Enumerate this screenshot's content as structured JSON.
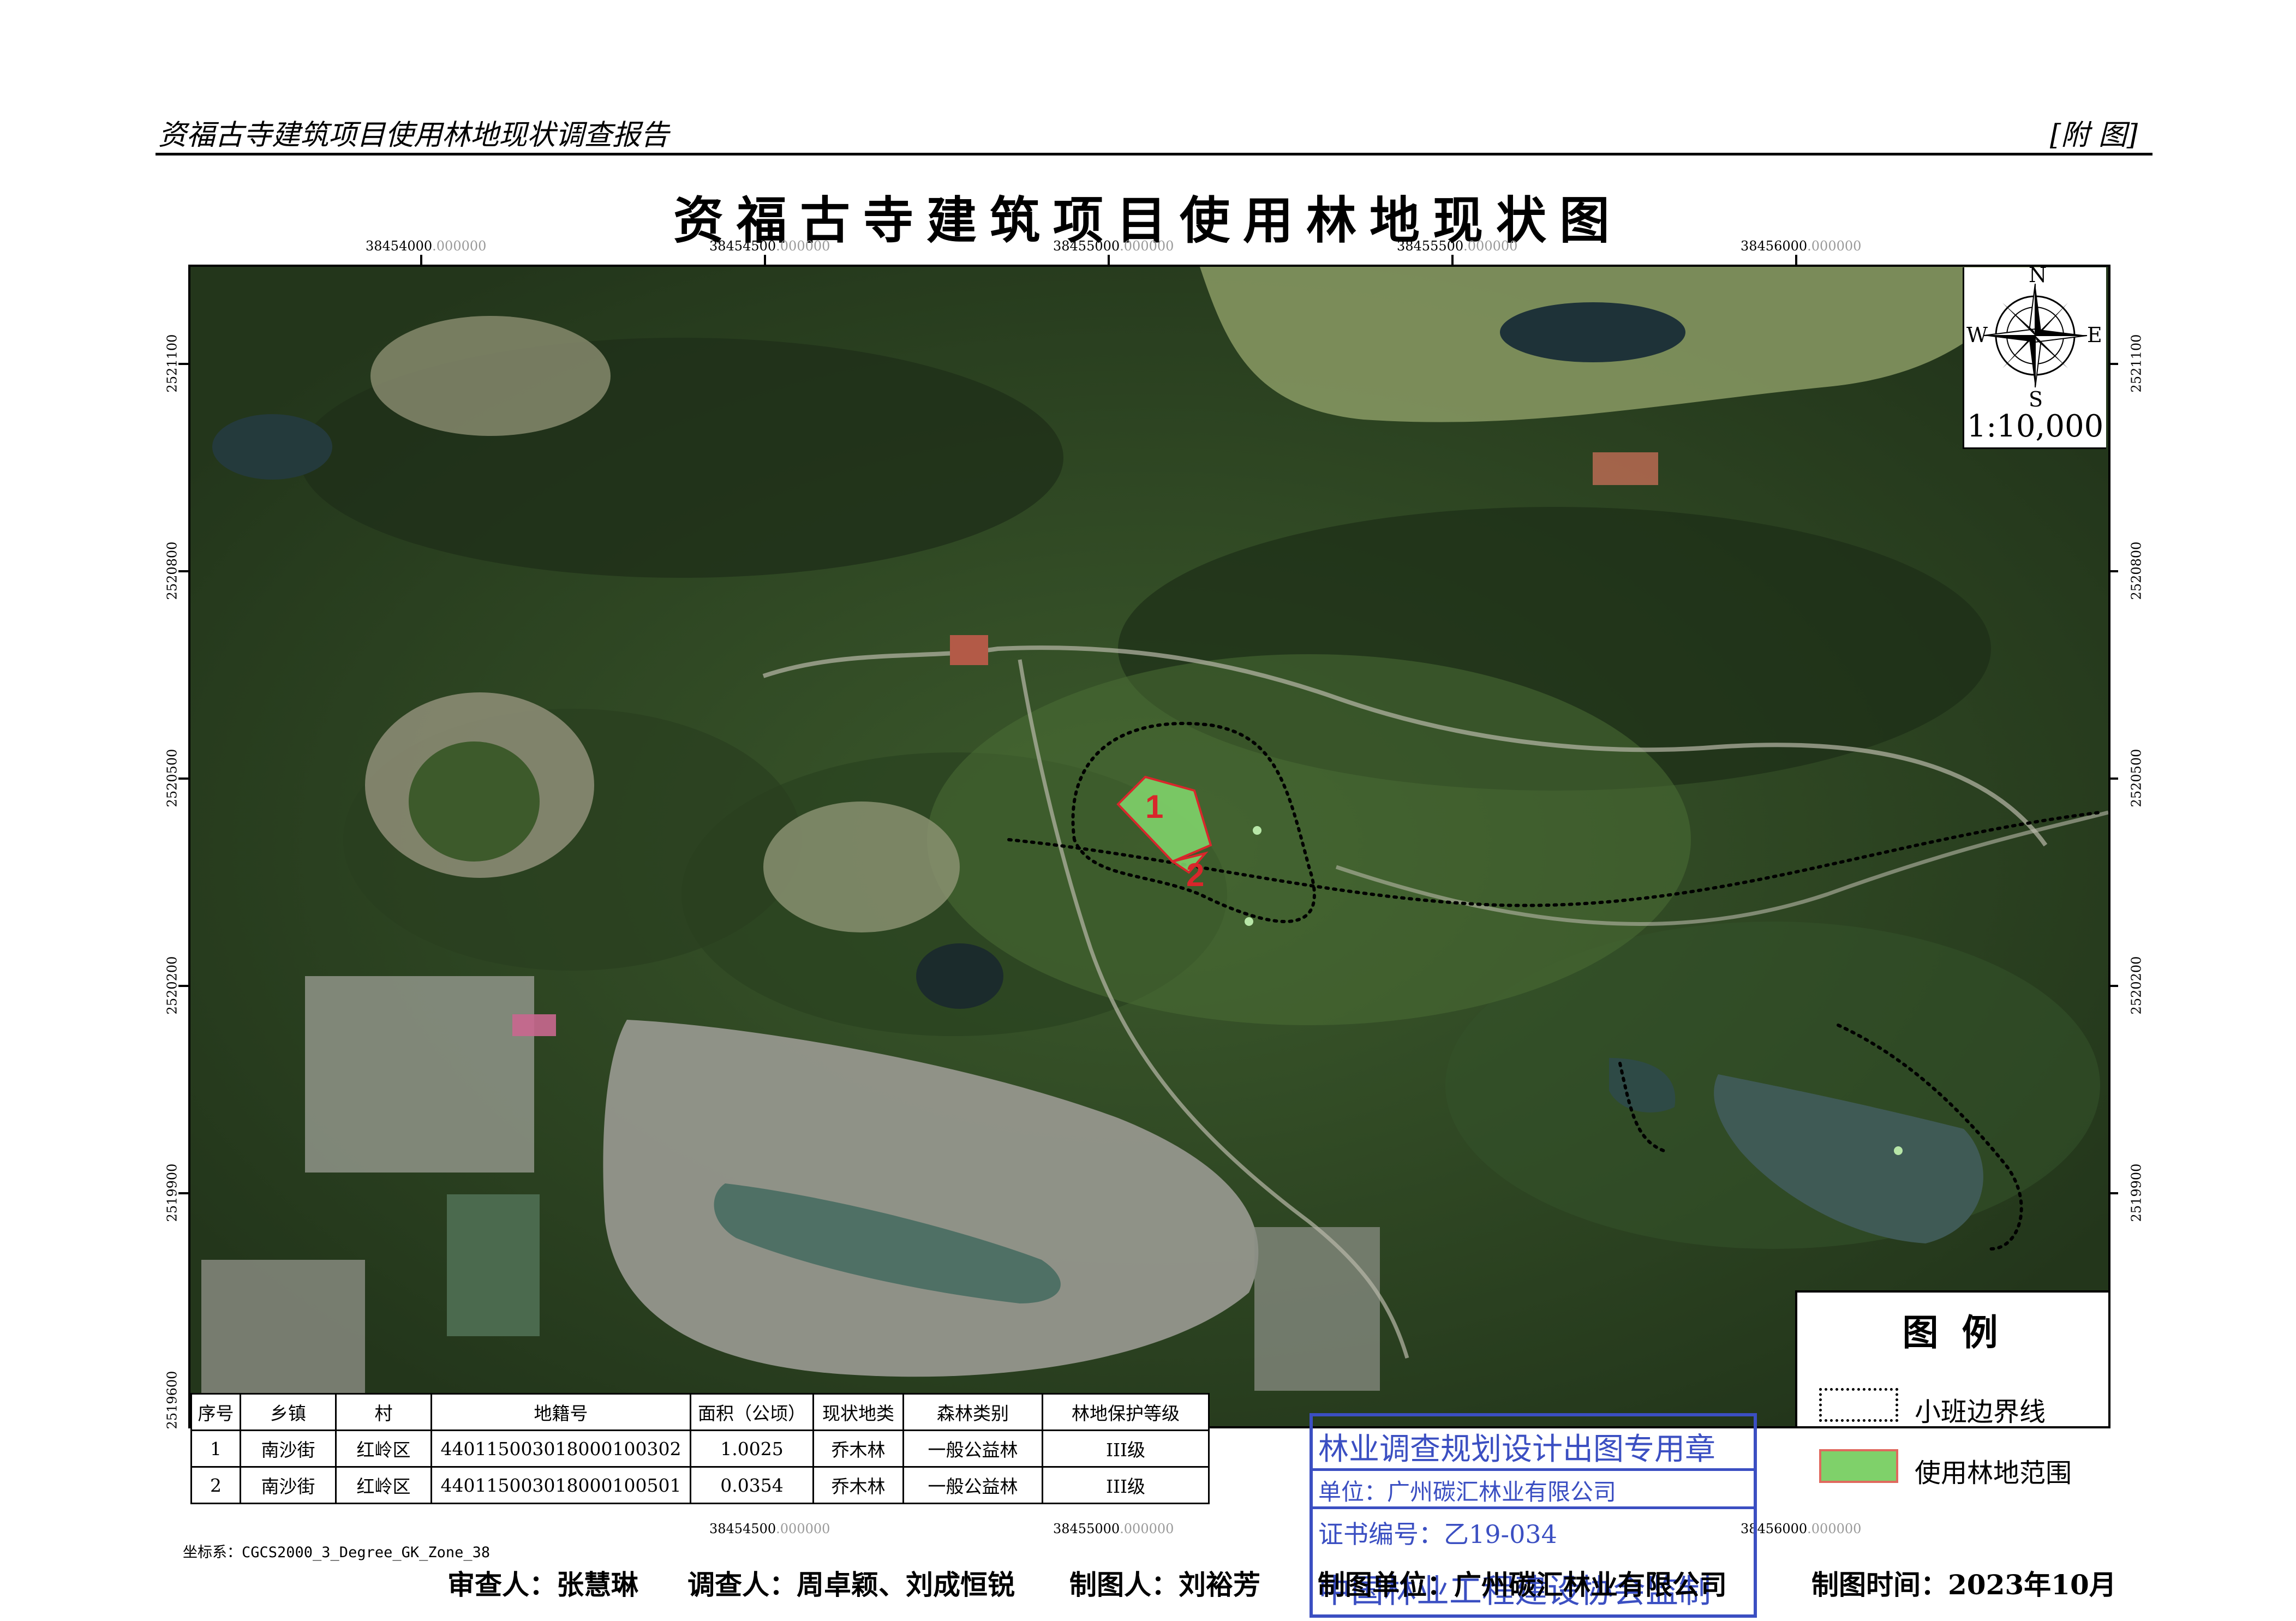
{
  "header": {
    "report_title": "资福古寺建筑项目使用林地现状调查报告",
    "section": "[附 图]"
  },
  "map_title": "资福古寺建筑项目使用林地现状图",
  "x_coords": [
    {
      "main": "38454000",
      "decimal": ".000000"
    },
    {
      "main": "38454500",
      "decimal": ".000000"
    },
    {
      "main": "38455000",
      "decimal": ".000000"
    },
    {
      "main": "38455500",
      "decimal": ".000000"
    },
    {
      "main": "38456000",
      "decimal": ".000000"
    }
  ],
  "y_coords": [
    "2521100",
    "2520800",
    "2520500",
    "2520200",
    "2519900",
    "2519600"
  ],
  "compass": {
    "n": "N",
    "s": "S",
    "e": "E",
    "w": "W",
    "scale": "1:10,000"
  },
  "plot_labels": {
    "p1": "1",
    "p2": "2"
  },
  "legend": {
    "title": "图 例",
    "items": [
      {
        "label": "小班边界线",
        "style": "dotted-boundary"
      },
      {
        "label": "使用林地范围",
        "style": "green-fill",
        "fill": "#7fd16a",
        "stroke": "#e0695e"
      }
    ]
  },
  "table": {
    "headers": [
      "序号",
      "乡镇",
      "村",
      "地籍号",
      "面积（公顷）",
      "现状地类",
      "森林类别",
      "林地保护等级"
    ],
    "rows": [
      [
        "1",
        "南沙街",
        "红岭区",
        "440115003018000100302",
        "1.0025",
        "乔木林",
        "一般公益林",
        "III级"
      ],
      [
        "2",
        "南沙街",
        "红岭区",
        "440115003018000100501",
        "0.0354",
        "乔木林",
        "一般公益林",
        "III级"
      ]
    ]
  },
  "stamp": {
    "line1": "林业调查规划设计出图专用章",
    "line2": "单位：广州碳汇林业有限公司",
    "line3": "证书编号：乙19-034",
    "line4": "中国林业工程建设协会监制"
  },
  "crs": "坐标系：CGCS2000_3_Degree_GK_Zone_38",
  "footer": {
    "reviewer": "审查人：张慧琳",
    "investigators": "调查人：周卓颖、刘成恒锐",
    "drafter": "制图人：刘裕芳",
    "unit": "制图单位：广州碳汇林业有限公司",
    "date": "制图时间：2023年10月"
  },
  "colors": {
    "forest": "#2e4a24",
    "water": "#2f4a45",
    "plot_fill": "#7fd16a",
    "plot_stroke": "#d9262b",
    "stamp": "#3b4fc2"
  }
}
